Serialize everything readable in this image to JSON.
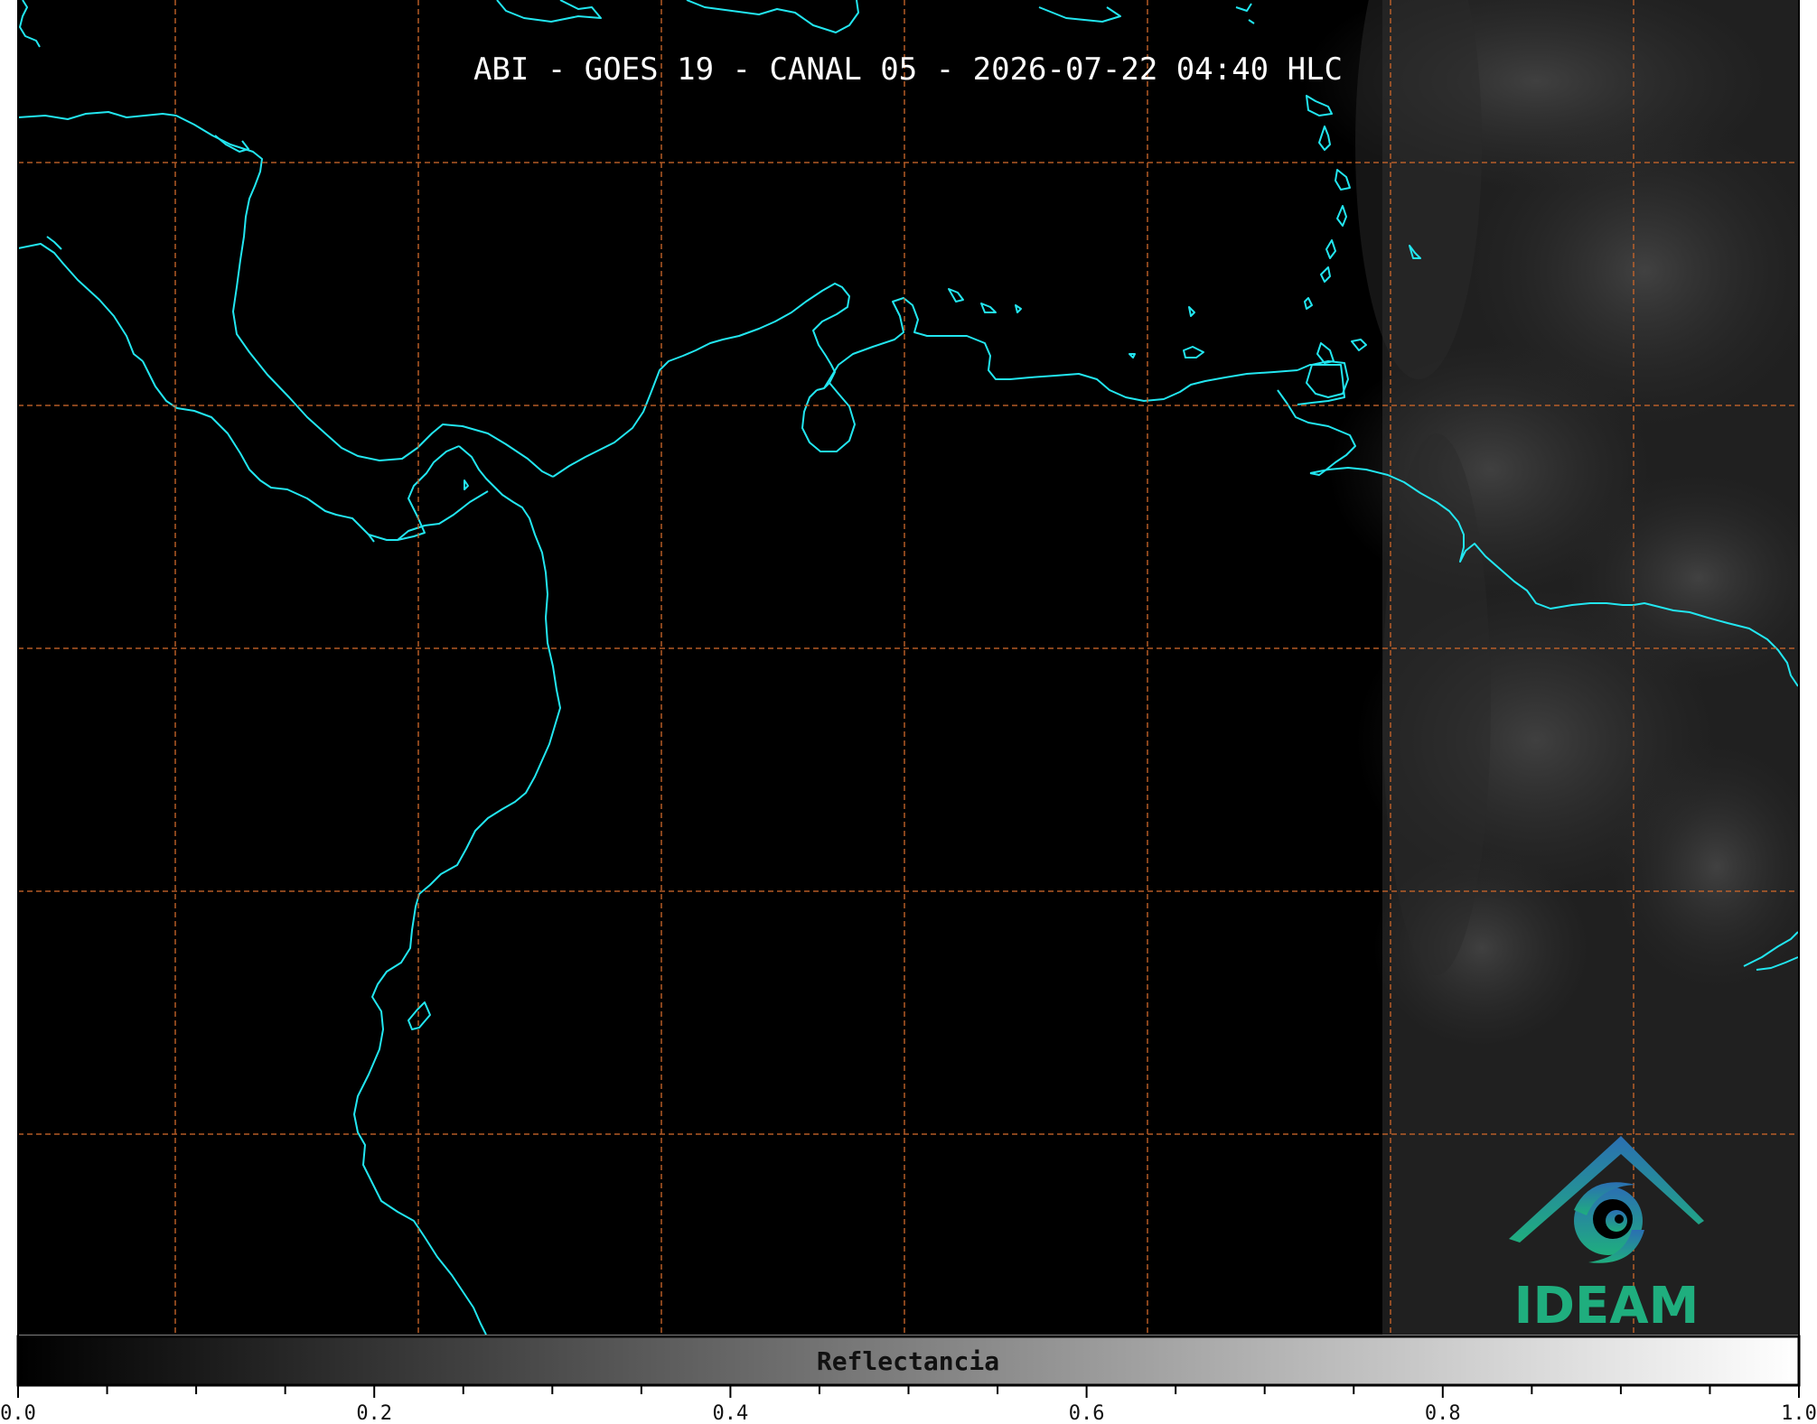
{
  "map": {
    "title": "ABI - GOES 19 - CANAL 05 - 2026-07-22 04:40 HLC",
    "background_color": "#000000",
    "coastline_color": "#22e6f0",
    "gridline_color": "#c8652a",
    "gridline_style": "dashed",
    "cloud_region": "east (right side)"
  },
  "logo": {
    "text": "IDEAM",
    "colors": [
      "#2b6fb3",
      "#1fae7e"
    ]
  },
  "colorbar": {
    "label": "Reflectancia",
    "colormap": "grayscale",
    "range": [
      0.0,
      1.0
    ],
    "tick_labels": [
      "0.0",
      "0.2",
      "0.4",
      "0.6",
      "0.8",
      "1.0"
    ]
  }
}
